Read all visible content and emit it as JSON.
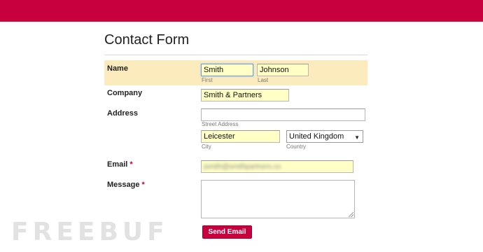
{
  "page": {
    "title": "Contact Form",
    "accent_color": "#c8003e",
    "highlight_color": "#fcebbd",
    "autofill_color": "#ffffc6"
  },
  "form": {
    "name": {
      "label": "Name",
      "first": {
        "value": "Smith",
        "sublabel": "First"
      },
      "last": {
        "value": "Johnson",
        "sublabel": "Last"
      }
    },
    "company": {
      "label": "Company",
      "value": "Smith & Partners"
    },
    "address": {
      "label": "Address",
      "street": {
        "value": "",
        "sublabel": "Street Address"
      },
      "city": {
        "value": "Leicester",
        "sublabel": "City"
      },
      "country": {
        "value": "United Kingdom",
        "sublabel": "Country"
      }
    },
    "email": {
      "label": "Email",
      "required_mark": "*",
      "value": "jsmith@smithpartners.co"
    },
    "message": {
      "label": "Message",
      "required_mark": "*",
      "value": ""
    },
    "submit_label": "Send Email"
  },
  "watermark": {
    "text": "FREEBUF"
  }
}
